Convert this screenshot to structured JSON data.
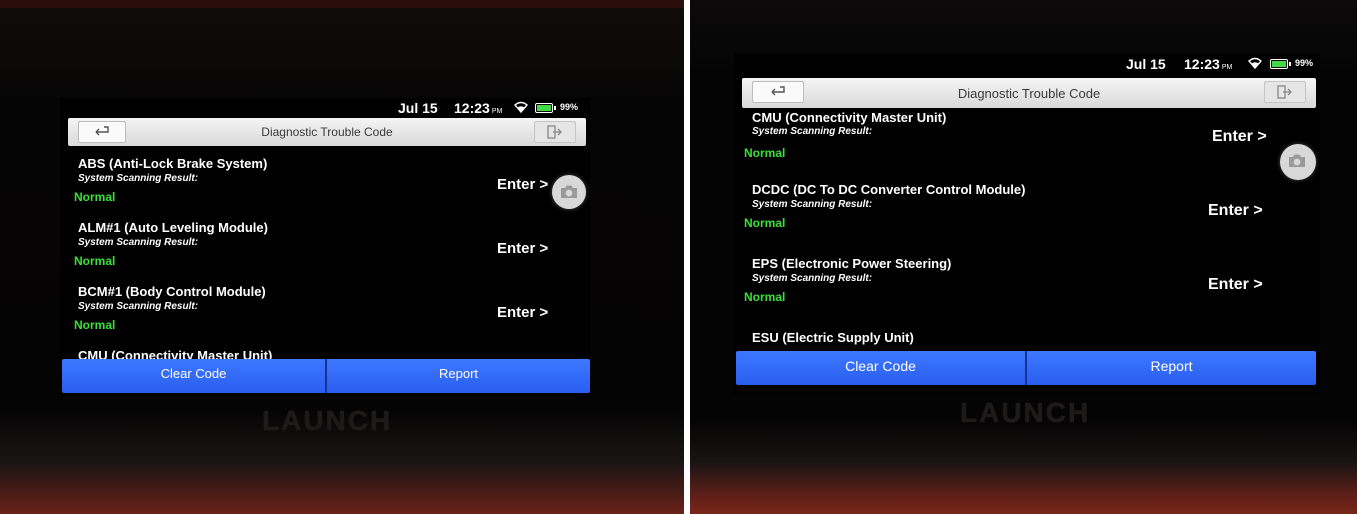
{
  "status": {
    "date": "Jul 15",
    "time": "12:23",
    "ampm": "PM",
    "battery": "99%"
  },
  "header": {
    "title": "Diagnostic Trouble Code"
  },
  "common": {
    "sub_label": "System Scanning Result:",
    "enter_label": "Enter >"
  },
  "left_screen": {
    "modules": [
      {
        "name": "ABS (Anti-Lock Brake System)",
        "status": "Normal"
      },
      {
        "name": "ALM#1 (Auto Leveling Module)",
        "status": "Normal"
      },
      {
        "name": "BCM#1 (Body Control Module)",
        "status": "Normal"
      }
    ],
    "partial_next": "CMU (Connectivity Master Unit)"
  },
  "right_screen": {
    "modules": [
      {
        "name": "CMU (Connectivity Master Unit)",
        "status": "Normal"
      },
      {
        "name": "DCDC (DC To DC Converter Control Module)",
        "status": "Normal"
      },
      {
        "name": "EPS (Electronic Power Steering)",
        "status": "Normal"
      }
    ],
    "partial_next": "ESU (Electric Supply Unit)"
  },
  "footer": {
    "clear_code": "Clear Code",
    "report": "Report"
  },
  "brand": "LAUNCH",
  "colors": {
    "status_normal": "#37e137",
    "action_bar": "#2f66f5",
    "battery_fill": "#42d84a"
  }
}
